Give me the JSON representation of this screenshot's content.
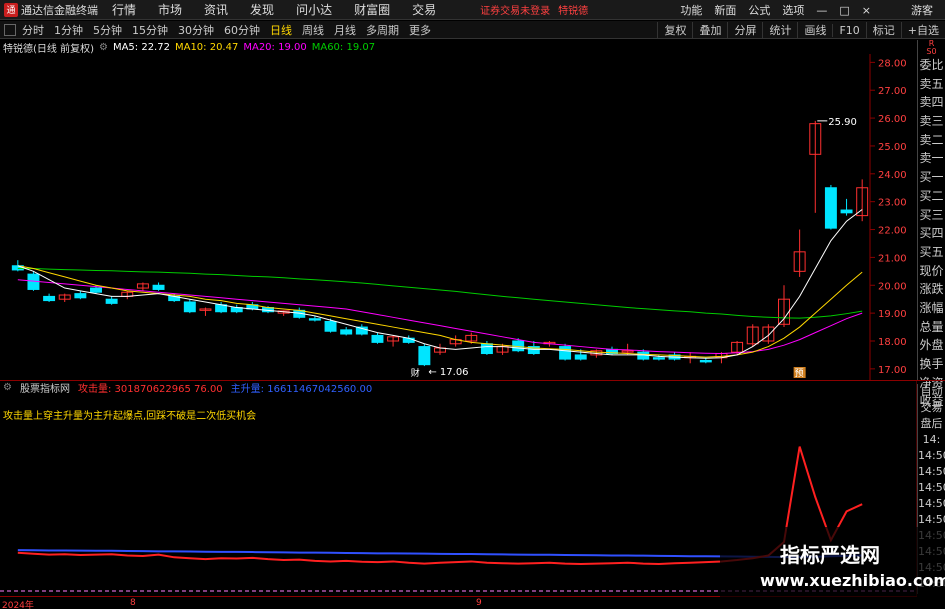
{
  "app": {
    "name": "通达信金融终端",
    "logo_char": "通"
  },
  "menu": [
    "行情",
    "市场",
    "资讯",
    "发现",
    "问小达",
    "财富圈",
    "交易"
  ],
  "warning": "证券交易未登录",
  "stock_link": "特锐德",
  "top_right": [
    "功能",
    "新面",
    "公式",
    "选项",
    "—",
    "□",
    "×",
    "游客"
  ],
  "periods": {
    "items": [
      "分时",
      "1分钟",
      "5分钟",
      "15分钟",
      "30分钟",
      "60分钟",
      "日线",
      "周线",
      "月线",
      "多周期",
      "更多"
    ],
    "active": "日线"
  },
  "toolbar": [
    "复权",
    "叠加",
    "分屏",
    "统计",
    "画线",
    "F10",
    "标记",
    "+自选"
  ],
  "title": {
    "stock": "特锐德(日线 前复权)",
    "ma5": "MA5: 22.72",
    "ma10": "MA10: 20.47",
    "ma20": "MA20: 19.00",
    "ma60": "MA60: 19.07"
  },
  "colors": {
    "ma5": "#ffffff",
    "ma10": "#ffd700",
    "ma20": "#ff00ff",
    "ma60": "#00cc00",
    "up": "#ff3030",
    "down": "#00e5ff"
  },
  "right_panel": [
    "委比",
    "卖五",
    "卖四",
    "卖三",
    "卖二",
    "卖一",
    "买一",
    "买二",
    "买三",
    "买四",
    "买五",
    "现价",
    "涨跌",
    "涨幅",
    "总量",
    "外盘",
    "换手",
    "净资",
    "收益"
  ],
  "right_panel_top": "R",
  "right_panel_top2": "S0",
  "right_panel2": [
    "自动",
    "交易",
    "盘后",
    "14:",
    "14:50",
    "14:50",
    "14:50",
    "14:50",
    "14:50",
    "14:50",
    "14:50",
    "14:50",
    "14:50"
  ],
  "indicator": {
    "name": "股票指标网",
    "line1": "攻击量: 301870622965 76.00",
    "line2": "主升量: 16611467042560.00"
  },
  "note": "攻击量上穿主升量为主升起爆点,回踩不破是二次低买机会",
  "xaxis": [
    "2024年",
    "8",
    "9"
  ],
  "watermark": {
    "line1": "指标严选网",
    "line2": "www.xuezhibiao.com"
  },
  "chart_data": {
    "type": "candlestick",
    "y_ticks": [
      17.0,
      18.0,
      19.0,
      20.0,
      21.0,
      22.0,
      23.0,
      24.0,
      25.0,
      26.0,
      27.0,
      28.0
    ],
    "ylim": [
      16.6,
      28.3
    ],
    "annotations": {
      "high": "25.90",
      "low": "17.06",
      "flag1": "财",
      "flag2": "预"
    },
    "candles": [
      [
        20.7,
        20.9,
        20.5,
        20.55
      ],
      [
        20.4,
        20.5,
        19.8,
        19.85
      ],
      [
        19.6,
        19.7,
        19.4,
        19.45
      ],
      [
        19.5,
        19.7,
        19.4,
        19.65
      ],
      [
        19.7,
        19.8,
        19.5,
        19.55
      ],
      [
        19.9,
        20.0,
        19.7,
        19.75
      ],
      [
        19.5,
        19.6,
        19.3,
        19.35
      ],
      [
        19.6,
        19.8,
        19.5,
        19.75
      ],
      [
        19.9,
        20.1,
        19.8,
        20.05
      ],
      [
        20.0,
        20.1,
        19.8,
        19.85
      ],
      [
        19.6,
        19.7,
        19.4,
        19.45
      ],
      [
        19.4,
        19.5,
        19.0,
        19.05
      ],
      [
        19.1,
        19.2,
        18.9,
        19.15
      ],
      [
        19.3,
        19.4,
        19.0,
        19.05
      ],
      [
        19.2,
        19.3,
        19.0,
        19.05
      ],
      [
        19.3,
        19.4,
        19.1,
        19.15
      ],
      [
        19.2,
        19.25,
        19.0,
        19.05
      ],
      [
        19.0,
        19.1,
        18.9,
        19.08
      ],
      [
        19.1,
        19.2,
        18.8,
        18.85
      ],
      [
        18.8,
        18.9,
        18.7,
        18.75
      ],
      [
        18.7,
        18.8,
        18.3,
        18.35
      ],
      [
        18.4,
        18.5,
        18.2,
        18.25
      ],
      [
        18.5,
        18.6,
        18.2,
        18.25
      ],
      [
        18.2,
        18.3,
        17.9,
        17.95
      ],
      [
        18.0,
        18.2,
        17.8,
        18.15
      ],
      [
        18.1,
        18.2,
        17.9,
        17.95
      ],
      [
        17.8,
        17.9,
        17.1,
        17.15
      ],
      [
        17.6,
        17.9,
        17.5,
        17.75
      ],
      [
        17.9,
        18.2,
        17.8,
        18.05
      ],
      [
        18.0,
        18.3,
        17.9,
        18.2
      ],
      [
        17.9,
        18.0,
        17.5,
        17.55
      ],
      [
        17.6,
        17.9,
        17.5,
        17.8
      ],
      [
        18.0,
        18.1,
        17.6,
        17.65
      ],
      [
        17.8,
        18.0,
        17.5,
        17.55
      ],
      [
        17.9,
        18.0,
        17.8,
        17.95
      ],
      [
        17.8,
        17.9,
        17.3,
        17.35
      ],
      [
        17.5,
        17.7,
        17.3,
        17.35
      ],
      [
        17.5,
        17.7,
        17.4,
        17.65
      ],
      [
        17.7,
        17.8,
        17.5,
        17.55
      ],
      [
        17.6,
        17.9,
        17.5,
        17.65
      ],
      [
        17.6,
        17.7,
        17.3,
        17.35
      ],
      [
        17.4,
        17.5,
        17.3,
        17.35
      ],
      [
        17.5,
        17.6,
        17.3,
        17.35
      ],
      [
        17.4,
        17.6,
        17.2,
        17.45
      ],
      [
        17.3,
        17.4,
        17.2,
        17.25
      ],
      [
        17.4,
        17.6,
        17.2,
        17.55
      ],
      [
        17.6,
        18.0,
        17.5,
        17.95
      ],
      [
        17.9,
        18.6,
        17.8,
        18.5
      ],
      [
        18.0,
        18.6,
        17.9,
        18.5
      ],
      [
        18.6,
        20.0,
        18.5,
        19.5
      ],
      [
        20.5,
        22.0,
        20.3,
        21.2
      ],
      [
        24.7,
        25.9,
        22.6,
        25.8
      ],
      [
        23.5,
        23.6,
        22.0,
        22.05
      ],
      [
        22.7,
        23.1,
        22.5,
        22.6
      ],
      [
        22.5,
        23.8,
        22.3,
        23.5
      ]
    ],
    "ma5": [
      20.7,
      20.5,
      20.2,
      19.9,
      19.8,
      19.7,
      19.6,
      19.6,
      19.65,
      19.7,
      19.6,
      19.5,
      19.4,
      19.3,
      19.2,
      19.15,
      19.1,
      19.05,
      19.0,
      18.9,
      18.75,
      18.6,
      18.45,
      18.3,
      18.2,
      18.1,
      17.9,
      17.75,
      17.7,
      17.75,
      17.8,
      17.8,
      17.75,
      17.7,
      17.7,
      17.65,
      17.6,
      17.55,
      17.5,
      17.5,
      17.5,
      17.45,
      17.42,
      17.4,
      17.38,
      17.4,
      17.5,
      17.8,
      18.2,
      18.8,
      19.6,
      20.6,
      21.6,
      22.3,
      22.72
    ],
    "ma10": [
      20.7,
      20.6,
      20.45,
      20.3,
      20.15,
      20.0,
      19.9,
      19.8,
      19.75,
      19.7,
      19.65,
      19.6,
      19.5,
      19.45,
      19.35,
      19.3,
      19.2,
      19.15,
      19.1,
      19.0,
      18.9,
      18.8,
      18.7,
      18.6,
      18.5,
      18.4,
      18.3,
      18.2,
      18.05,
      17.95,
      17.9,
      17.85,
      17.8,
      17.75,
      17.72,
      17.7,
      17.65,
      17.6,
      17.58,
      17.55,
      17.52,
      17.5,
      17.48,
      17.45,
      17.42,
      17.45,
      17.5,
      17.6,
      17.8,
      18.1,
      18.5,
      19.0,
      19.5,
      20.0,
      20.47
    ],
    "ma20": [
      20.2,
      20.15,
      20.1,
      20.05,
      20.0,
      19.95,
      19.9,
      19.85,
      19.8,
      19.75,
      19.7,
      19.65,
      19.6,
      19.55,
      19.5,
      19.45,
      19.4,
      19.35,
      19.3,
      19.25,
      19.2,
      19.15,
      19.05,
      18.95,
      18.85,
      18.75,
      18.65,
      18.55,
      18.45,
      18.35,
      18.25,
      18.15,
      18.05,
      17.95,
      17.9,
      17.85,
      17.8,
      17.75,
      17.7,
      17.68,
      17.65,
      17.62,
      17.6,
      17.58,
      17.56,
      17.55,
      17.58,
      17.62,
      17.7,
      17.85,
      18.05,
      18.3,
      18.55,
      18.8,
      19.0
    ],
    "ma60": [
      20.6,
      20.6,
      20.58,
      20.56,
      20.55,
      20.53,
      20.52,
      20.5,
      20.48,
      20.47,
      20.45,
      20.43,
      20.4,
      20.38,
      20.35,
      20.32,
      20.3,
      20.27,
      20.23,
      20.2,
      20.16,
      20.12,
      20.08,
      20.03,
      19.98,
      19.93,
      19.88,
      19.83,
      19.78,
      19.72,
      19.66,
      19.6,
      19.55,
      19.5,
      19.45,
      19.4,
      19.35,
      19.3,
      19.25,
      19.2,
      19.16,
      19.12,
      19.08,
      19.05,
      19.0,
      18.97,
      18.92,
      18.88,
      18.85,
      18.83,
      18.82,
      18.85,
      18.9,
      18.98,
      19.07
    ],
    "indicator_blue": [
      0.94,
      0.93,
      0.92,
      0.92,
      0.91,
      0.9,
      0.9,
      0.89,
      0.88,
      0.87,
      0.87,
      0.86,
      0.85,
      0.84,
      0.84,
      0.83,
      0.82,
      0.81,
      0.8,
      0.8,
      0.79,
      0.78,
      0.77,
      0.76,
      0.76,
      0.75,
      0.74,
      0.73,
      0.72,
      0.72,
      0.71,
      0.7,
      0.69,
      0.68,
      0.68,
      0.67,
      0.66,
      0.65,
      0.64,
      0.64,
      0.63,
      0.62,
      0.61,
      0.6,
      0.6,
      0.59,
      0.58,
      0.57,
      0.56,
      0.55,
      0.56,
      0.57,
      0.6,
      0.62,
      0.64
    ],
    "indicator_red": [
      0.9,
      0.85,
      0.8,
      0.82,
      0.78,
      0.8,
      0.82,
      0.75,
      0.72,
      0.8,
      0.65,
      0.6,
      0.55,
      0.6,
      0.58,
      0.62,
      0.55,
      0.5,
      0.52,
      0.45,
      0.42,
      0.45,
      0.4,
      0.38,
      0.42,
      0.35,
      0.3,
      0.35,
      0.38,
      0.42,
      0.35,
      0.32,
      0.3,
      0.32,
      0.35,
      0.3,
      0.28,
      0.3,
      0.32,
      0.35,
      0.3,
      0.28,
      0.32,
      0.35,
      0.38,
      0.42,
      0.5,
      0.6,
      0.75,
      1.5,
      6.8,
      4.0,
      1.6,
      3.2,
      3.6
    ]
  }
}
